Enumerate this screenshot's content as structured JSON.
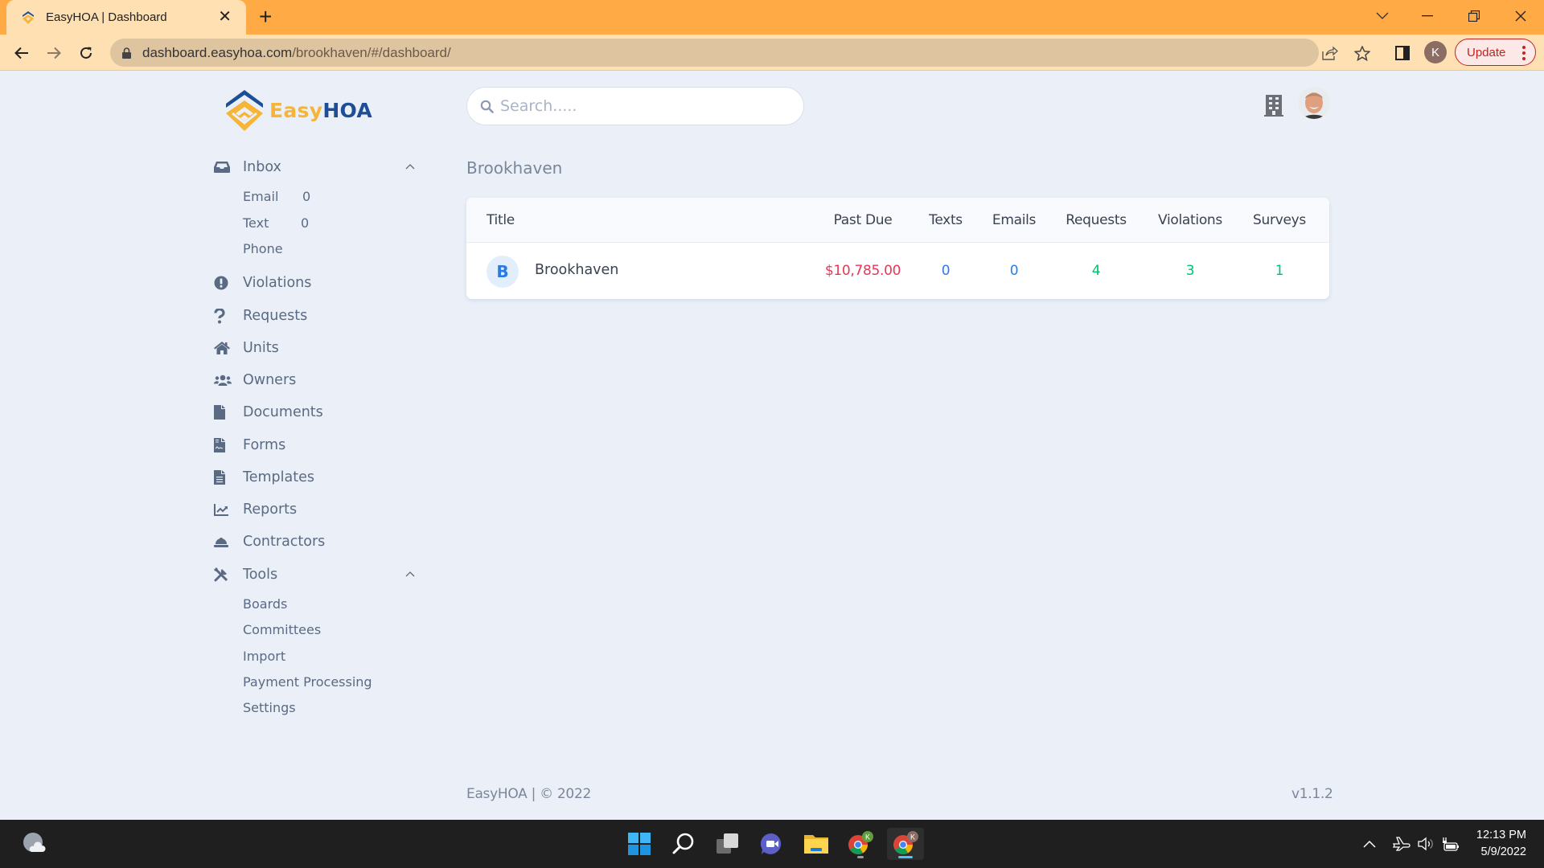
{
  "browser": {
    "tab_title": "EasyHOA | Dashboard",
    "url_host": "dashboard.easyhoa.com",
    "url_path": "/brookhaven/#/dashboard/",
    "profile_initial": "K",
    "update_label": "Update"
  },
  "app": {
    "brand_part1": "Easy",
    "brand_part2": "HOA",
    "search_placeholder": "Search.....",
    "search_value": ""
  },
  "sidebar": {
    "inbox": {
      "label": "Inbox",
      "icon": "inbox-icon",
      "expanded": true,
      "children": [
        {
          "label": "Email",
          "count": "0"
        },
        {
          "label": "Text",
          "count": "0"
        },
        {
          "label": "Phone",
          "count": ""
        }
      ]
    },
    "items": [
      {
        "label": "Violations",
        "icon": "exclamation-circle-icon"
      },
      {
        "label": "Requests",
        "icon": "question-icon"
      },
      {
        "label": "Units",
        "icon": "home-icon"
      },
      {
        "label": "Owners",
        "icon": "users-icon"
      },
      {
        "label": "Documents",
        "icon": "file-icon"
      },
      {
        "label": "Forms",
        "icon": "file-signature-icon"
      },
      {
        "label": "Templates",
        "icon": "file-alt-icon"
      },
      {
        "label": "Reports",
        "icon": "chart-line-icon"
      },
      {
        "label": "Contractors",
        "icon": "hard-hat-icon"
      }
    ],
    "tools": {
      "label": "Tools",
      "icon": "tools-icon",
      "expanded": true,
      "children": [
        {
          "label": "Boards"
        },
        {
          "label": "Committees"
        },
        {
          "label": "Import"
        },
        {
          "label": "Payment Processing"
        },
        {
          "label": "Settings"
        }
      ]
    }
  },
  "main": {
    "page_title": "Brookhaven",
    "table": {
      "columns": [
        "Title",
        "Past Due",
        "Texts",
        "Emails",
        "Requests",
        "Violations",
        "Surveys"
      ],
      "rows": [
        {
          "initial": "B",
          "title": "Brookhaven",
          "past_due": "$10,785.00",
          "texts": "0",
          "emails": "0",
          "requests": "4",
          "violations": "3",
          "surveys": "1"
        }
      ]
    }
  },
  "footer": {
    "copyright": "EasyHOA | © 2022",
    "version": "v1.1.2"
  },
  "colors": {
    "past_due": "#E63757",
    "count_blue": "#2C7BE5",
    "count_green": "#00D27A",
    "brand_orange": "#F7B538",
    "brand_blue": "#1E4E96",
    "chrome_orange": "#FFAA44"
  },
  "taskbar": {
    "time": "12:13 PM",
    "date": "5/9/2022",
    "pinned": [
      "start-icon",
      "search-icon",
      "task-view-icon",
      "teams-chat-icon",
      "file-explorer-icon",
      "chrome-profile-k-green-icon",
      "chrome-profile-k-brown-icon"
    ]
  }
}
